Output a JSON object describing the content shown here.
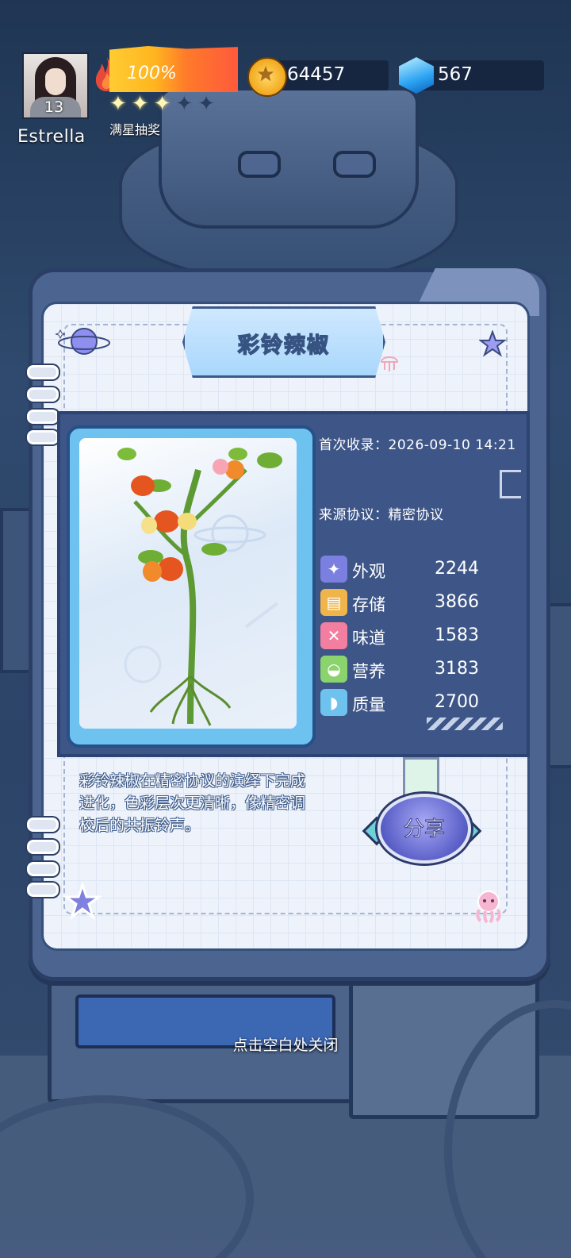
{
  "player": {
    "name": "Estrella",
    "level": "13",
    "energy_percent": "100%",
    "stars_filled": 3,
    "stars_total": 5,
    "lottery_label": "满星抽奖"
  },
  "currency": {
    "gold": "64457",
    "gems": "567"
  },
  "card": {
    "title": "彩铃辣椒",
    "first_record": "首次收录：2026-09-10 14:21",
    "source": "来源协议：精密协议",
    "stats": [
      {
        "icon": "sparkle-icon",
        "label": "外观",
        "value": "2244",
        "color": "#7b7fe0"
      },
      {
        "icon": "storage-box-icon",
        "label": "存储",
        "value": "3866",
        "color": "#f0b54a"
      },
      {
        "icon": "fork-knife-icon",
        "label": "味道",
        "value": "1583",
        "color": "#f27ea0"
      },
      {
        "icon": "leaf-bowl-icon",
        "label": "营养",
        "value": "3183",
        "color": "#8bd36d"
      },
      {
        "icon": "muscle-icon",
        "label": "质量",
        "value": "2700",
        "color": "#6ec3ee"
      }
    ],
    "description": "彩铃辣椒在精密协议的演绎下完成进化，色彩层次更清晰，像精密调校后的共振铃声。",
    "share_label": "分享"
  },
  "close_hint": "点击空白处关闭"
}
